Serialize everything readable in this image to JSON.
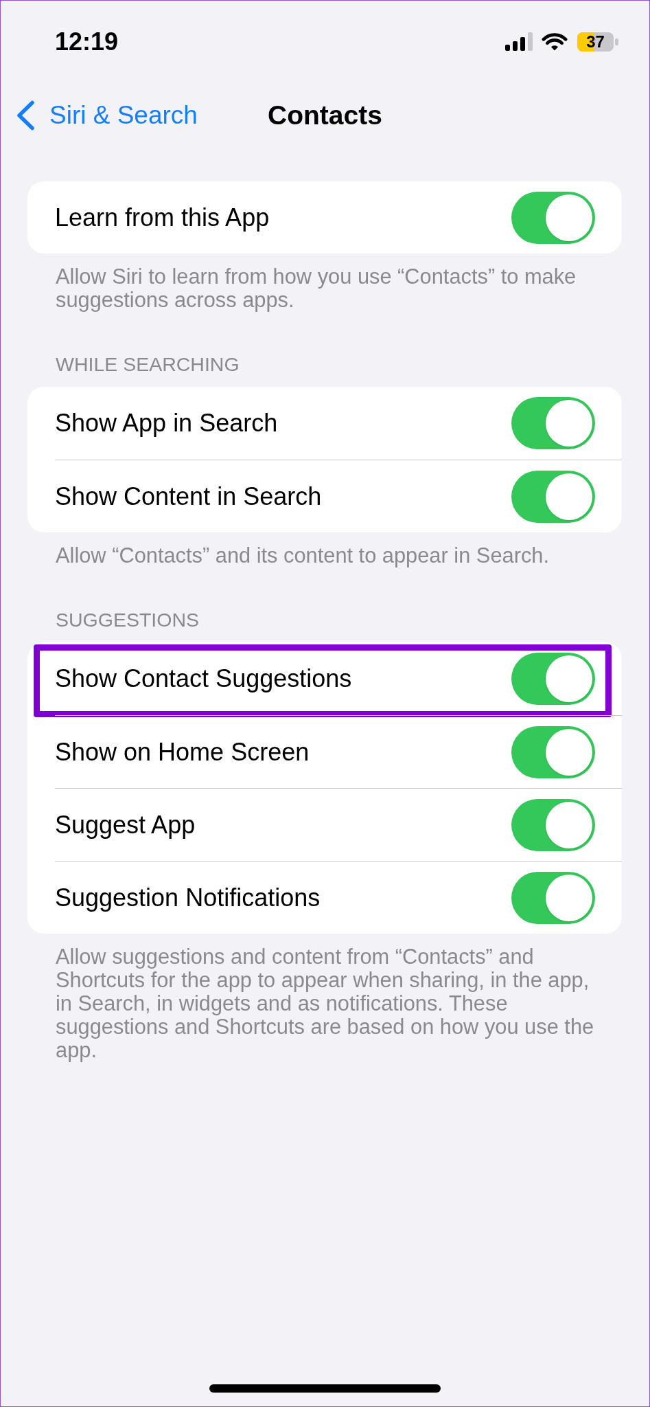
{
  "status_bar": {
    "time": "12:19",
    "battery": "37"
  },
  "nav": {
    "back": "Siri & Search",
    "title": "Contacts"
  },
  "sections": [
    {
      "rows": [
        {
          "label": "Learn from this App",
          "on": true,
          "highlighted": false
        }
      ],
      "footer": "Allow Siri to learn from how you use “Contacts” to make suggestions across apps."
    },
    {
      "header": "WHILE SEARCHING",
      "rows": [
        {
          "label": "Show App in Search",
          "on": true,
          "highlighted": false
        },
        {
          "label": "Show Content in Search",
          "on": true,
          "highlighted": false
        }
      ],
      "footer": "Allow “Contacts” and its content to appear in Search."
    },
    {
      "header": "SUGGESTIONS",
      "rows": [
        {
          "label": "Show Contact Suggestions",
          "on": true,
          "highlighted": true
        },
        {
          "label": "Show on Home Screen",
          "on": true,
          "highlighted": false
        },
        {
          "label": "Suggest App",
          "on": true,
          "highlighted": false
        },
        {
          "label": "Suggestion Notifications",
          "on": true,
          "highlighted": false
        }
      ],
      "footer": "Allow suggestions and content from “Contacts” and Shortcuts for the app to appear when sharing, in the app, in Search, in widgets and as notifications. These suggestions and Shortcuts are based on how you use the app."
    }
  ]
}
